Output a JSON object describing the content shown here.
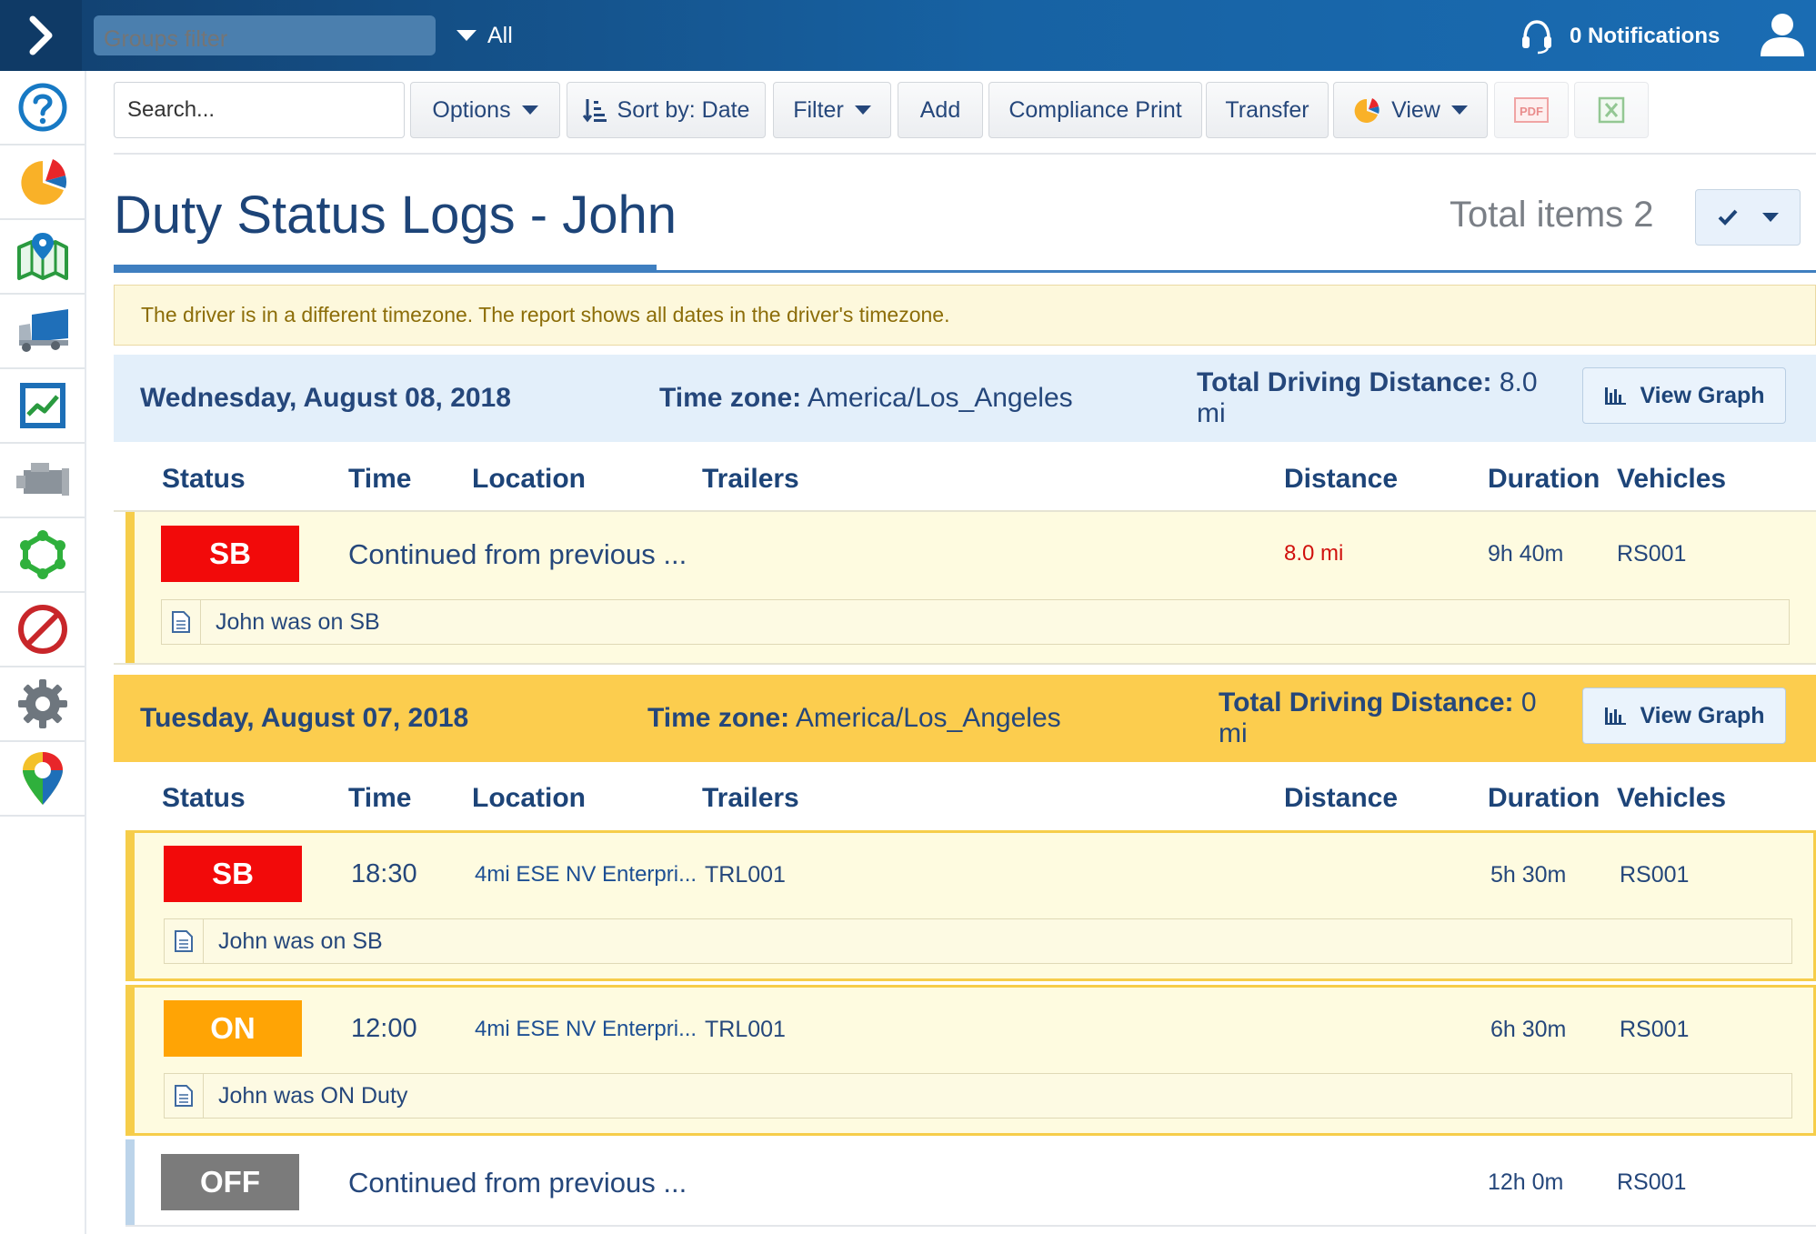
{
  "topbar": {
    "groups_filter_placeholder": "Groups filter",
    "groups_selected": "All",
    "notifications": "0 Notifications"
  },
  "sidebar": {
    "items": [
      {
        "icon": "help-icon"
      },
      {
        "icon": "dashboard-pie-icon"
      },
      {
        "icon": "map-icon"
      },
      {
        "icon": "truck-icon"
      },
      {
        "icon": "activity-report-icon"
      },
      {
        "icon": "engine-icon"
      },
      {
        "icon": "zones-icon"
      },
      {
        "icon": "rules-icon"
      },
      {
        "icon": "settings-gear-icon"
      },
      {
        "icon": "marketplace-icon"
      }
    ]
  },
  "toolbar": {
    "search_placeholder": "Search...",
    "options": "Options",
    "sort": "Sort by: Date",
    "filter": "Filter",
    "add": "Add",
    "compliance_print": "Compliance Print",
    "transfer": "Transfer",
    "view": "View",
    "pdf": "PDF"
  },
  "page": {
    "title": "Duty Status Logs - John",
    "total_items": "Total items 2",
    "tz_notice": "The driver is in a different timezone. The report shows all dates in the driver's timezone."
  },
  "columns": {
    "status": "Status",
    "time": "Time",
    "location": "Location",
    "trailers": "Trailers",
    "distance": "Distance",
    "duration": "Duration",
    "vehicles": "Vehicles"
  },
  "days": [
    {
      "date": "Wednesday, August 08, 2018",
      "tz_label": "Time zone:",
      "tz_value": "America/Los_Angeles",
      "dist_label": "Total Driving Distance:",
      "dist_value": "8.0 mi",
      "view_graph": "View Graph",
      "logs": [
        {
          "status": "SB",
          "time": "Continued from previous ...",
          "location": "",
          "trailers": "",
          "distance": "8.0 mi",
          "duration": "9h 40m",
          "vehicle": "RS001",
          "note": "John was on SB"
        }
      ]
    },
    {
      "date": "Tuesday, August 07, 2018",
      "tz_label": "Time zone:",
      "tz_value": "America/Los_Angeles",
      "dist_label": "Total Driving Distance:",
      "dist_value": "0 mi",
      "view_graph": "View Graph",
      "logs": [
        {
          "status": "SB",
          "time": "18:30",
          "location": "4mi ESE NV Enterpri...",
          "trailers": "TRL001",
          "distance": "",
          "duration": "5h 30m",
          "vehicle": "RS001",
          "note": "John was on SB"
        },
        {
          "status": "ON",
          "time": "12:00",
          "location": "4mi ESE NV Enterpri...",
          "trailers": "TRL001",
          "distance": "",
          "duration": "6h 30m",
          "vehicle": "RS001",
          "note": "John was ON Duty"
        },
        {
          "status": "OFF",
          "time": "Continued from previous ...",
          "location": "",
          "trailers": "",
          "distance": "",
          "duration": "12h 0m",
          "vehicle": "RS001",
          "note": ""
        }
      ]
    }
  ],
  "colors": {
    "sb": "#f20a0a",
    "on": "#ffa405",
    "off": "#7b7b7b",
    "accent": "#3f7fc0",
    "day_highlight": "#fccd4e"
  }
}
